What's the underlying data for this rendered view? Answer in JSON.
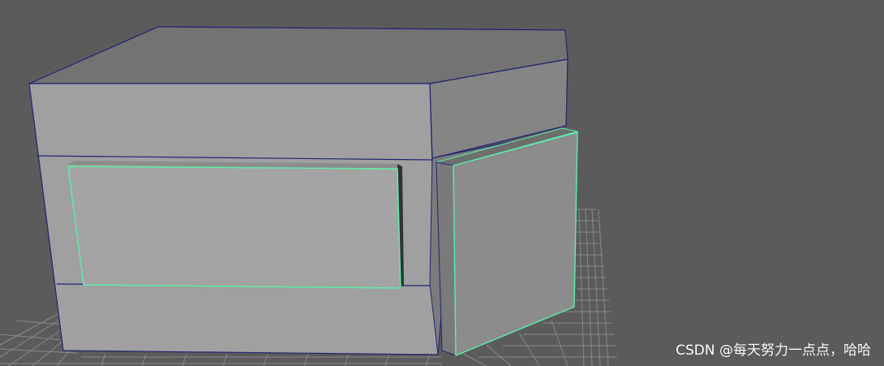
{
  "viewport": {
    "background": "#5b5b5b",
    "grid_color": "#8a8a8a"
  },
  "model": {
    "wire_color": "#1e2470",
    "selection_color": "#5cf0a8",
    "top_face_color": "#737373",
    "front_face_color": "#a0a0a0",
    "side_face_color": "#858585",
    "panel_color": "#a2a2a2",
    "door_color": "#8c8c8c"
  },
  "watermark": {
    "text": "CSDN @每天努力一点点，哈哈"
  }
}
